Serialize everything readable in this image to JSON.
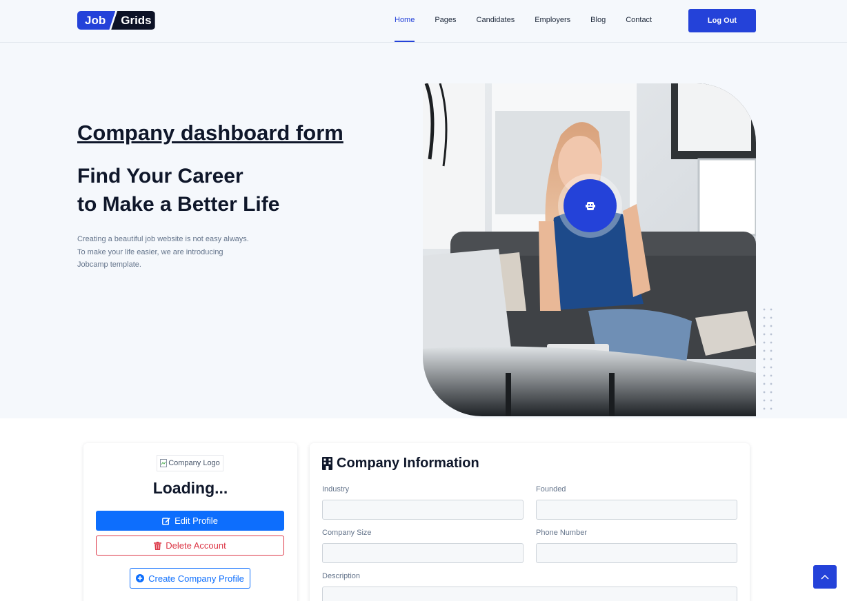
{
  "brand": {
    "part1": "Job",
    "part2": "Grids"
  },
  "nav": {
    "items": [
      "Home",
      "Pages",
      "Candidates",
      "Employers",
      "Blog",
      "Contact"
    ],
    "active_index": 0,
    "logout_label": "Log Out"
  },
  "hero": {
    "title": "Company dashboard form",
    "heading_line1": "Find Your Career",
    "heading_line2": "to Make a Better Life",
    "description": "Creating a beautiful job website is not easy always. To make your life easier, we are introducing Jobcamp template.",
    "play_icon": "play-icon"
  },
  "profile": {
    "logo_alt": "Company Logo",
    "name": "Loading...",
    "edit_label": "Edit Profile",
    "delete_label": "Delete Account",
    "create_label": "Create Company Profile"
  },
  "company_info": {
    "title": "Company Information",
    "fields": {
      "industry": {
        "label": "Industry",
        "value": ""
      },
      "founded": {
        "label": "Founded",
        "value": ""
      },
      "company_size": {
        "label": "Company Size",
        "value": ""
      },
      "phone": {
        "label": "Phone Number",
        "value": ""
      },
      "description": {
        "label": "Description",
        "value": ""
      }
    }
  },
  "colors": {
    "primary": "#2442d9",
    "bootstrap_primary": "#0d6efd",
    "danger": "#dc3545",
    "hero_bg": "#f5f8fc"
  }
}
